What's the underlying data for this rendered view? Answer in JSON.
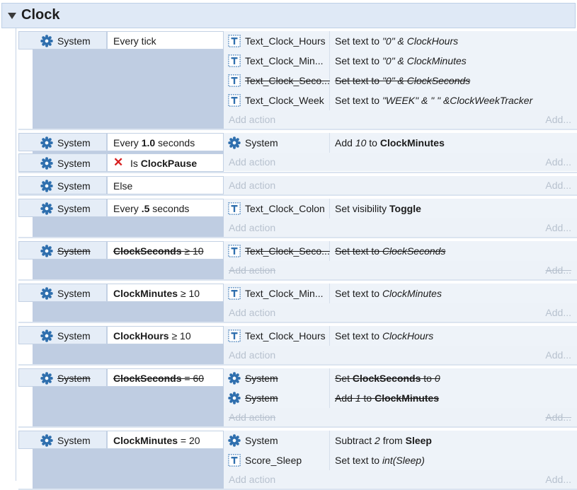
{
  "group": {
    "title": "Clock"
  },
  "add_action_label": "Add action",
  "add_label": "Add...",
  "events": [
    {
      "conditions": [
        {
          "object": "System",
          "parts": [
            {
              "t": "Every tick"
            }
          ],
          "disabled": false,
          "negated": false
        }
      ],
      "actions": [
        {
          "object": "Text_Clock_Hours",
          "icon": "text-object-icon",
          "parts": [
            {
              "t": "Set text to "
            },
            {
              "t": "\"0\" & ClockHours",
              "i": true
            }
          ],
          "disabled": false
        },
        {
          "object": "Text_Clock_Min...",
          "icon": "text-object-icon",
          "parts": [
            {
              "t": "Set text to "
            },
            {
              "t": "\"0\" & ClockMinutes",
              "i": true
            }
          ],
          "disabled": false
        },
        {
          "object": "Text_Clock_Seco...",
          "icon": "text-object-icon",
          "parts": [
            {
              "t": "Set text to "
            },
            {
              "t": "\"0\" & ClockSeconds",
              "i": true
            }
          ],
          "disabled": true
        },
        {
          "object": "Text_Clock_Week",
          "icon": "text-object-icon",
          "parts": [
            {
              "t": "Set text to "
            },
            {
              "t": "\"WEEK\" & \" \" &ClockWeekTracker",
              "i": true
            }
          ],
          "disabled": false
        }
      ],
      "add_disabled": false
    },
    {
      "conditions": [
        {
          "object": "System",
          "parts": [
            {
              "t": "Every "
            },
            {
              "t": "1.0",
              "b": true
            },
            {
              "t": " seconds"
            }
          ],
          "disabled": false,
          "negated": false
        },
        {
          "object": "System",
          "parts": [
            {
              "t": "Is "
            },
            {
              "t": "ClockPause",
              "b": true
            }
          ],
          "disabled": false,
          "negated": true
        }
      ],
      "actions": [
        {
          "object": "System",
          "icon": "gear-icon",
          "parts": [
            {
              "t": "Add "
            },
            {
              "t": "10",
              "i": true
            },
            {
              "t": " to "
            },
            {
              "t": "ClockMinutes",
              "b": true
            }
          ],
          "disabled": false
        }
      ],
      "add_disabled": false
    },
    {
      "conditions": [
        {
          "object": "System",
          "parts": [
            {
              "t": "Else"
            }
          ],
          "disabled": false,
          "negated": false
        }
      ],
      "actions": [],
      "add_disabled": false
    },
    {
      "conditions": [
        {
          "object": "System",
          "parts": [
            {
              "t": "Every "
            },
            {
              "t": ".5",
              "b": true
            },
            {
              "t": " seconds"
            }
          ],
          "disabled": false,
          "negated": false
        }
      ],
      "actions": [
        {
          "object": "Text_Clock_Colon",
          "icon": "text-object-icon",
          "parts": [
            {
              "t": "Set visibility "
            },
            {
              "t": "Toggle",
              "b": true
            }
          ],
          "disabled": false
        }
      ],
      "add_disabled": false
    },
    {
      "conditions": [
        {
          "object": "System",
          "parts": [
            {
              "t": "ClockSeconds",
              "b": true
            },
            {
              "t": " ≥ 10"
            }
          ],
          "disabled": true,
          "negated": false
        }
      ],
      "actions": [
        {
          "object": "Text_Clock_Seco...",
          "icon": "text-object-icon",
          "parts": [
            {
              "t": "Set text to "
            },
            {
              "t": "ClockSeconds",
              "i": true
            }
          ],
          "disabled": true
        }
      ],
      "add_disabled": true
    },
    {
      "conditions": [
        {
          "object": "System",
          "parts": [
            {
              "t": "ClockMinutes",
              "b": true
            },
            {
              "t": " ≥ 10"
            }
          ],
          "disabled": false,
          "negated": false
        }
      ],
      "actions": [
        {
          "object": "Text_Clock_Min...",
          "icon": "text-object-icon",
          "parts": [
            {
              "t": "Set text to "
            },
            {
              "t": "ClockMinutes",
              "i": true
            }
          ],
          "disabled": false
        }
      ],
      "add_disabled": false
    },
    {
      "conditions": [
        {
          "object": "System",
          "parts": [
            {
              "t": "ClockHours",
              "b": true
            },
            {
              "t": " ≥ 10"
            }
          ],
          "disabled": false,
          "negated": false
        }
      ],
      "actions": [
        {
          "object": "Text_Clock_Hours",
          "icon": "text-object-icon",
          "parts": [
            {
              "t": "Set text to "
            },
            {
              "t": "ClockHours",
              "i": true
            }
          ],
          "disabled": false
        }
      ],
      "add_disabled": false
    },
    {
      "conditions": [
        {
          "object": "System",
          "parts": [
            {
              "t": "ClockSeconds",
              "b": true
            },
            {
              "t": " = 60"
            }
          ],
          "disabled": true,
          "negated": false
        }
      ],
      "actions": [
        {
          "object": "System",
          "icon": "gear-icon",
          "parts": [
            {
              "t": "Set "
            },
            {
              "t": "ClockSeconds",
              "b": true
            },
            {
              "t": " to "
            },
            {
              "t": "0",
              "i": true
            }
          ],
          "disabled": true
        },
        {
          "object": "System",
          "icon": "gear-icon",
          "parts": [
            {
              "t": "Add "
            },
            {
              "t": "1",
              "i": true
            },
            {
              "t": " to "
            },
            {
              "t": "ClockMinutes",
              "b": true
            }
          ],
          "disabled": true
        }
      ],
      "add_disabled": true
    },
    {
      "conditions": [
        {
          "object": "System",
          "parts": [
            {
              "t": "ClockMinutes",
              "b": true
            },
            {
              "t": " = 20"
            }
          ],
          "disabled": false,
          "negated": false
        }
      ],
      "actions": [
        {
          "object": "System",
          "icon": "gear-icon",
          "parts": [
            {
              "t": "Subtract "
            },
            {
              "t": "2",
              "i": true
            },
            {
              "t": " from "
            },
            {
              "t": "Sleep",
              "b": true
            }
          ],
          "disabled": false
        },
        {
          "object": "Score_Sleep",
          "icon": "text-object-icon",
          "parts": [
            {
              "t": "Set text to "
            },
            {
              "t": "int(Sleep)",
              "i": true
            }
          ],
          "disabled": false
        }
      ],
      "add_disabled": false
    }
  ]
}
